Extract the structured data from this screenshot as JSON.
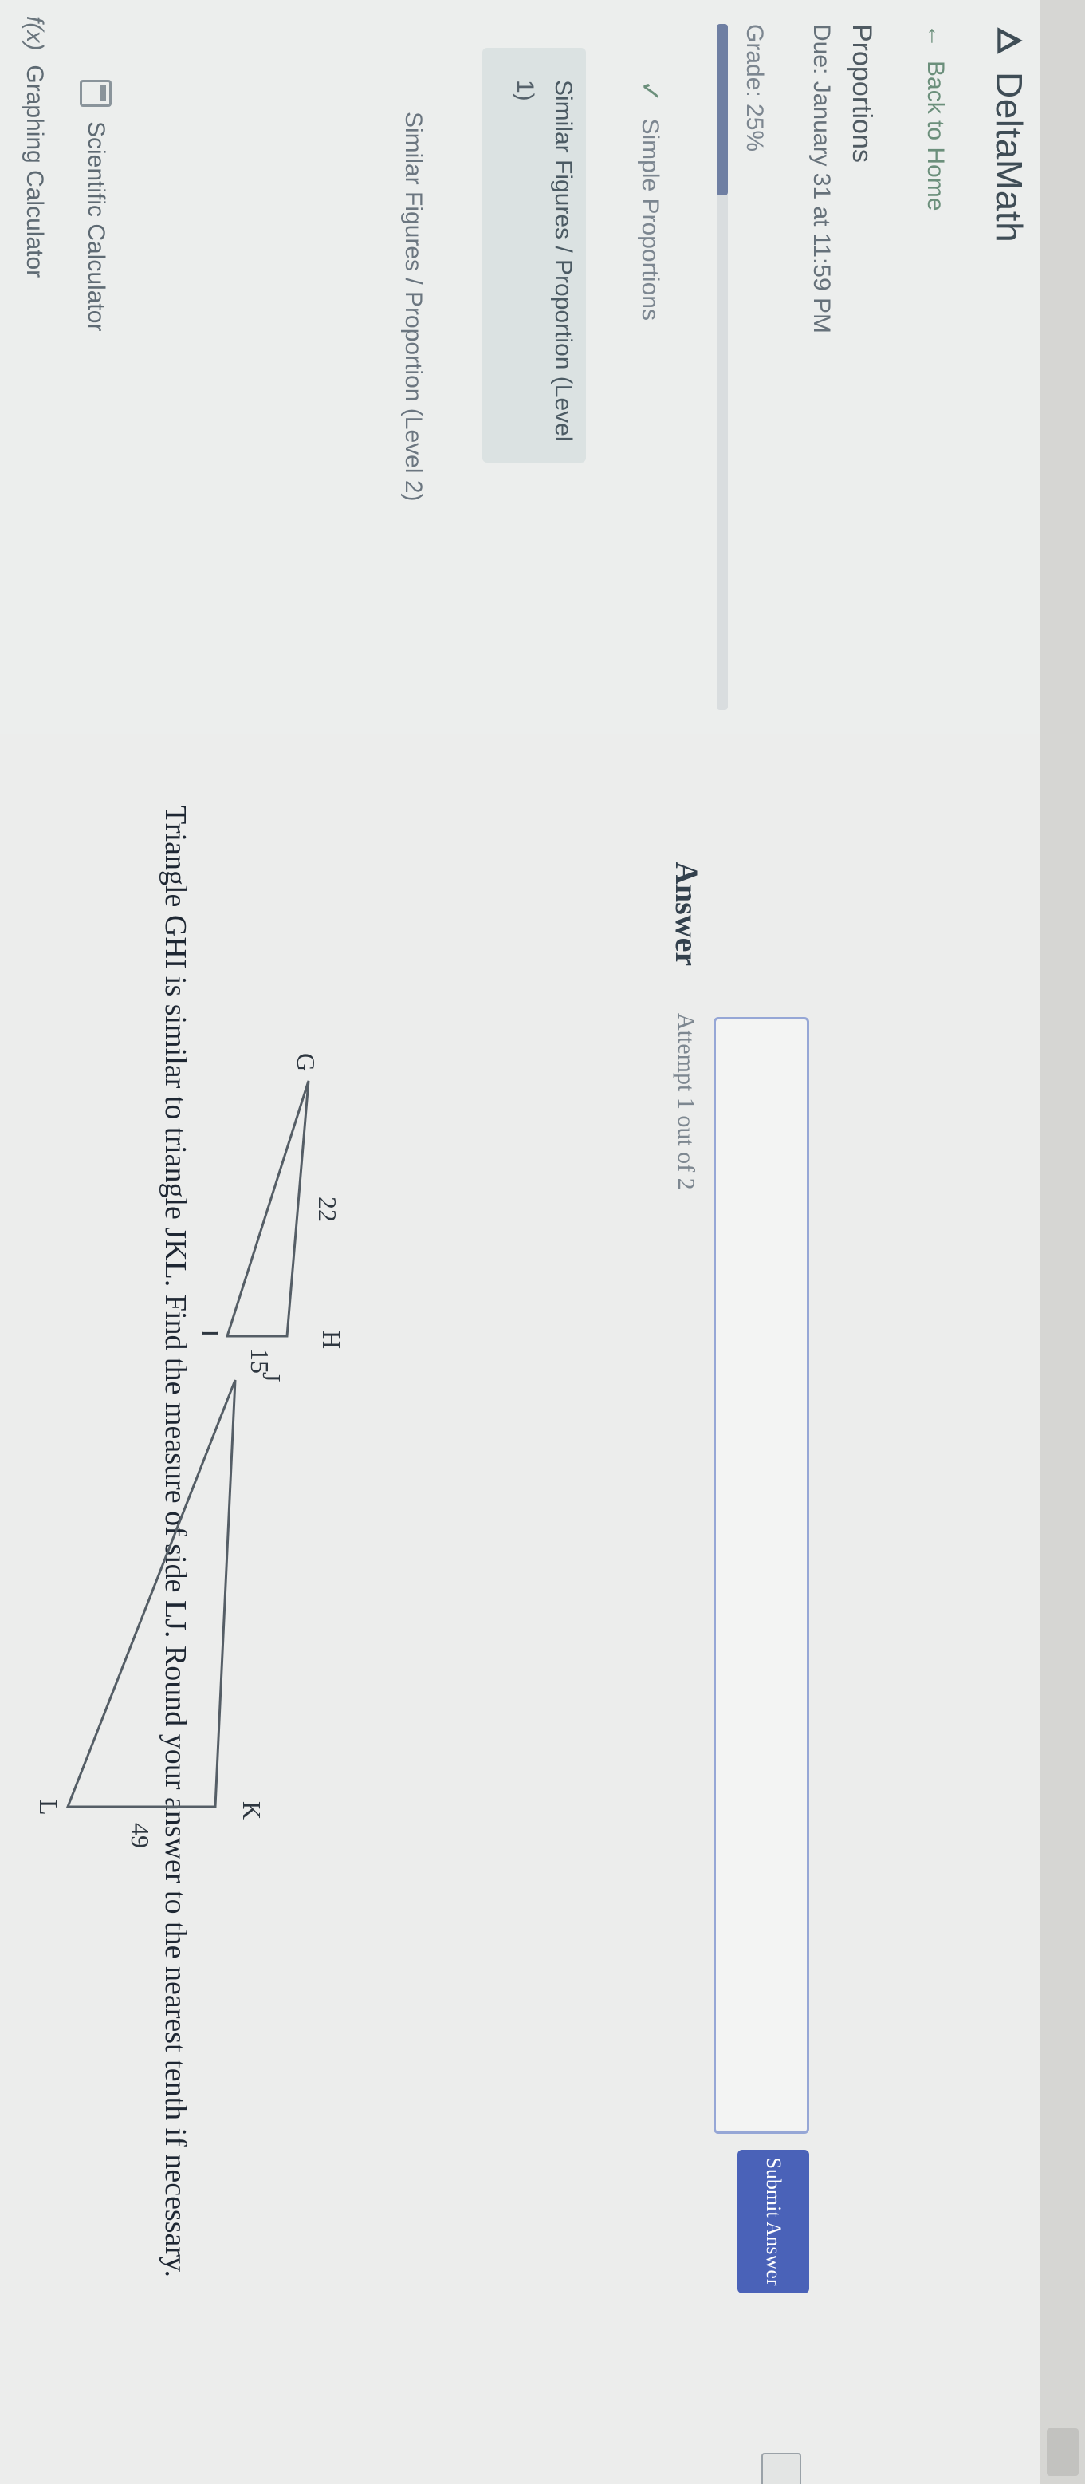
{
  "app": {
    "name": "DeltaMath"
  },
  "sidebar": {
    "back_label": "Back to Home",
    "back_icon": "arrow-left-icon",
    "assignment_title": "Proportions",
    "due_text": "Due: January 31 at 11:59 PM",
    "grade_text": "Grade: 25%",
    "grade_fraction": 0.25,
    "skill_label": "Simple Proportions",
    "problem_title": "Similar Figures / Proportion (Level",
    "problem_number": "1)",
    "subtitle": "Similar Figures / Proportion (Level 2)",
    "tools": [
      {
        "label": "Scientific Calculator",
        "icon": "calculator-icon"
      },
      {
        "label": "Graphing Calculator",
        "icon": "graph-icon",
        "icon_glyph": "f(x)"
      }
    ]
  },
  "question": {
    "text": "Triangle GHI is similar to triangle JKL. Find the measure of side LJ. Round your answer to the nearest tenth if necessary."
  },
  "figure": {
    "triangle1": {
      "labels": [
        "G",
        "H",
        "I"
      ],
      "side_GH": "22",
      "side_HI": "15"
    },
    "triangle2": {
      "labels": [
        "J",
        "K",
        "L"
      ],
      "side_KL": "49"
    }
  },
  "answer": {
    "label": "Answer",
    "attempt_text": "Attempt 1 out of 2",
    "input_value": "",
    "submit_label": "Submit Answer"
  },
  "colors": {
    "accent": "#4a62b8",
    "input_border": "#96a7d6",
    "link_green": "#6b8f7b",
    "progress": "#6f7fa3"
  }
}
